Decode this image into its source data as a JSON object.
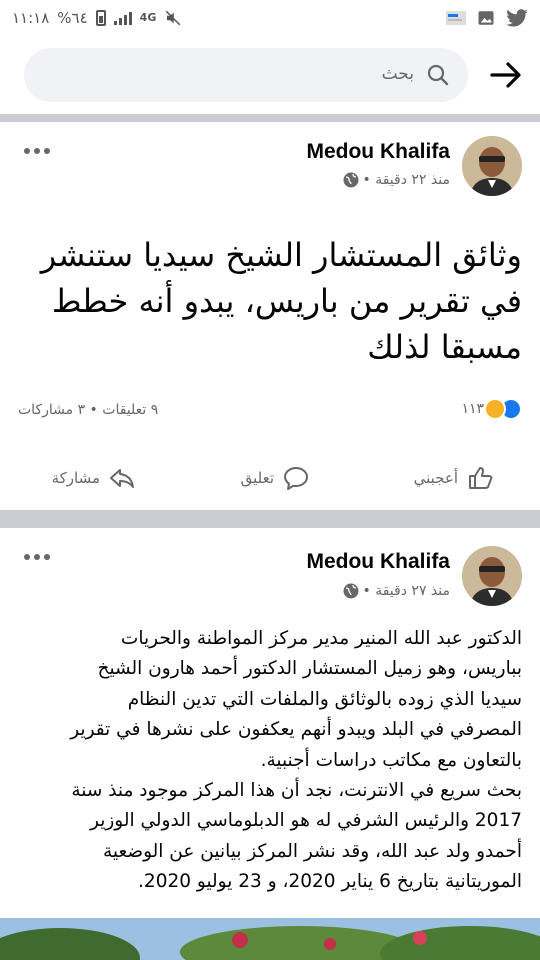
{
  "status_bar": {
    "time": "١١:١٨",
    "battery": "%٦٤",
    "network": "4G"
  },
  "search": {
    "placeholder": "بحث"
  },
  "posts": [
    {
      "author": "Medou Khalifa",
      "time": "منذ ٢٢ دقيقة •",
      "text": "وثائق المستشار الشيخ سيديا ستنشر في تقرير من باريس، يبدو أنه خطط مسبقا لذلك",
      "reactions_count": "١١٣",
      "comments_shares": "٩ تعليقات • ٣ مشاركات",
      "actions": {
        "like": "أعجبني",
        "comment": "تعليق",
        "share": "مشاركة"
      }
    },
    {
      "author": "Medou Khalifa",
      "time": "منذ ٢٧ دقيقة •",
      "text_lines": [
        "الدكتور عبد الله المنير مدير مركز المواطنة والحريات",
        "بباريس، وهو زميل المستشار الدكتور أحمد هارون الشيخ",
        "سيديا الذي زوده بالوثائق والملفات التي تدين النظام",
        "المصرفي في البلد ويبدو أنهم يعكفون على نشرها في تقرير",
        "بالتعاون مع مكاتب دراسات أجنبية.",
        "بحث سريع في الانترنت، نجد أن هذا المركز موجود منذ سنة",
        "2017 والرئيس الشرفي له هو الدبلوماسي الدولي الوزير",
        "أحمدو ولد عبد الله، وقد نشر المركز بيانين عن الوضعية",
        "الموريتانية بتاريخ 6 يناير 2020، و 23 يوليو 2020."
      ]
    }
  ],
  "colors": {
    "accent": "#1877f2",
    "secondary_text": "#65676b",
    "divider": "#c9ccd1",
    "search_bg": "#f0f2f5"
  }
}
